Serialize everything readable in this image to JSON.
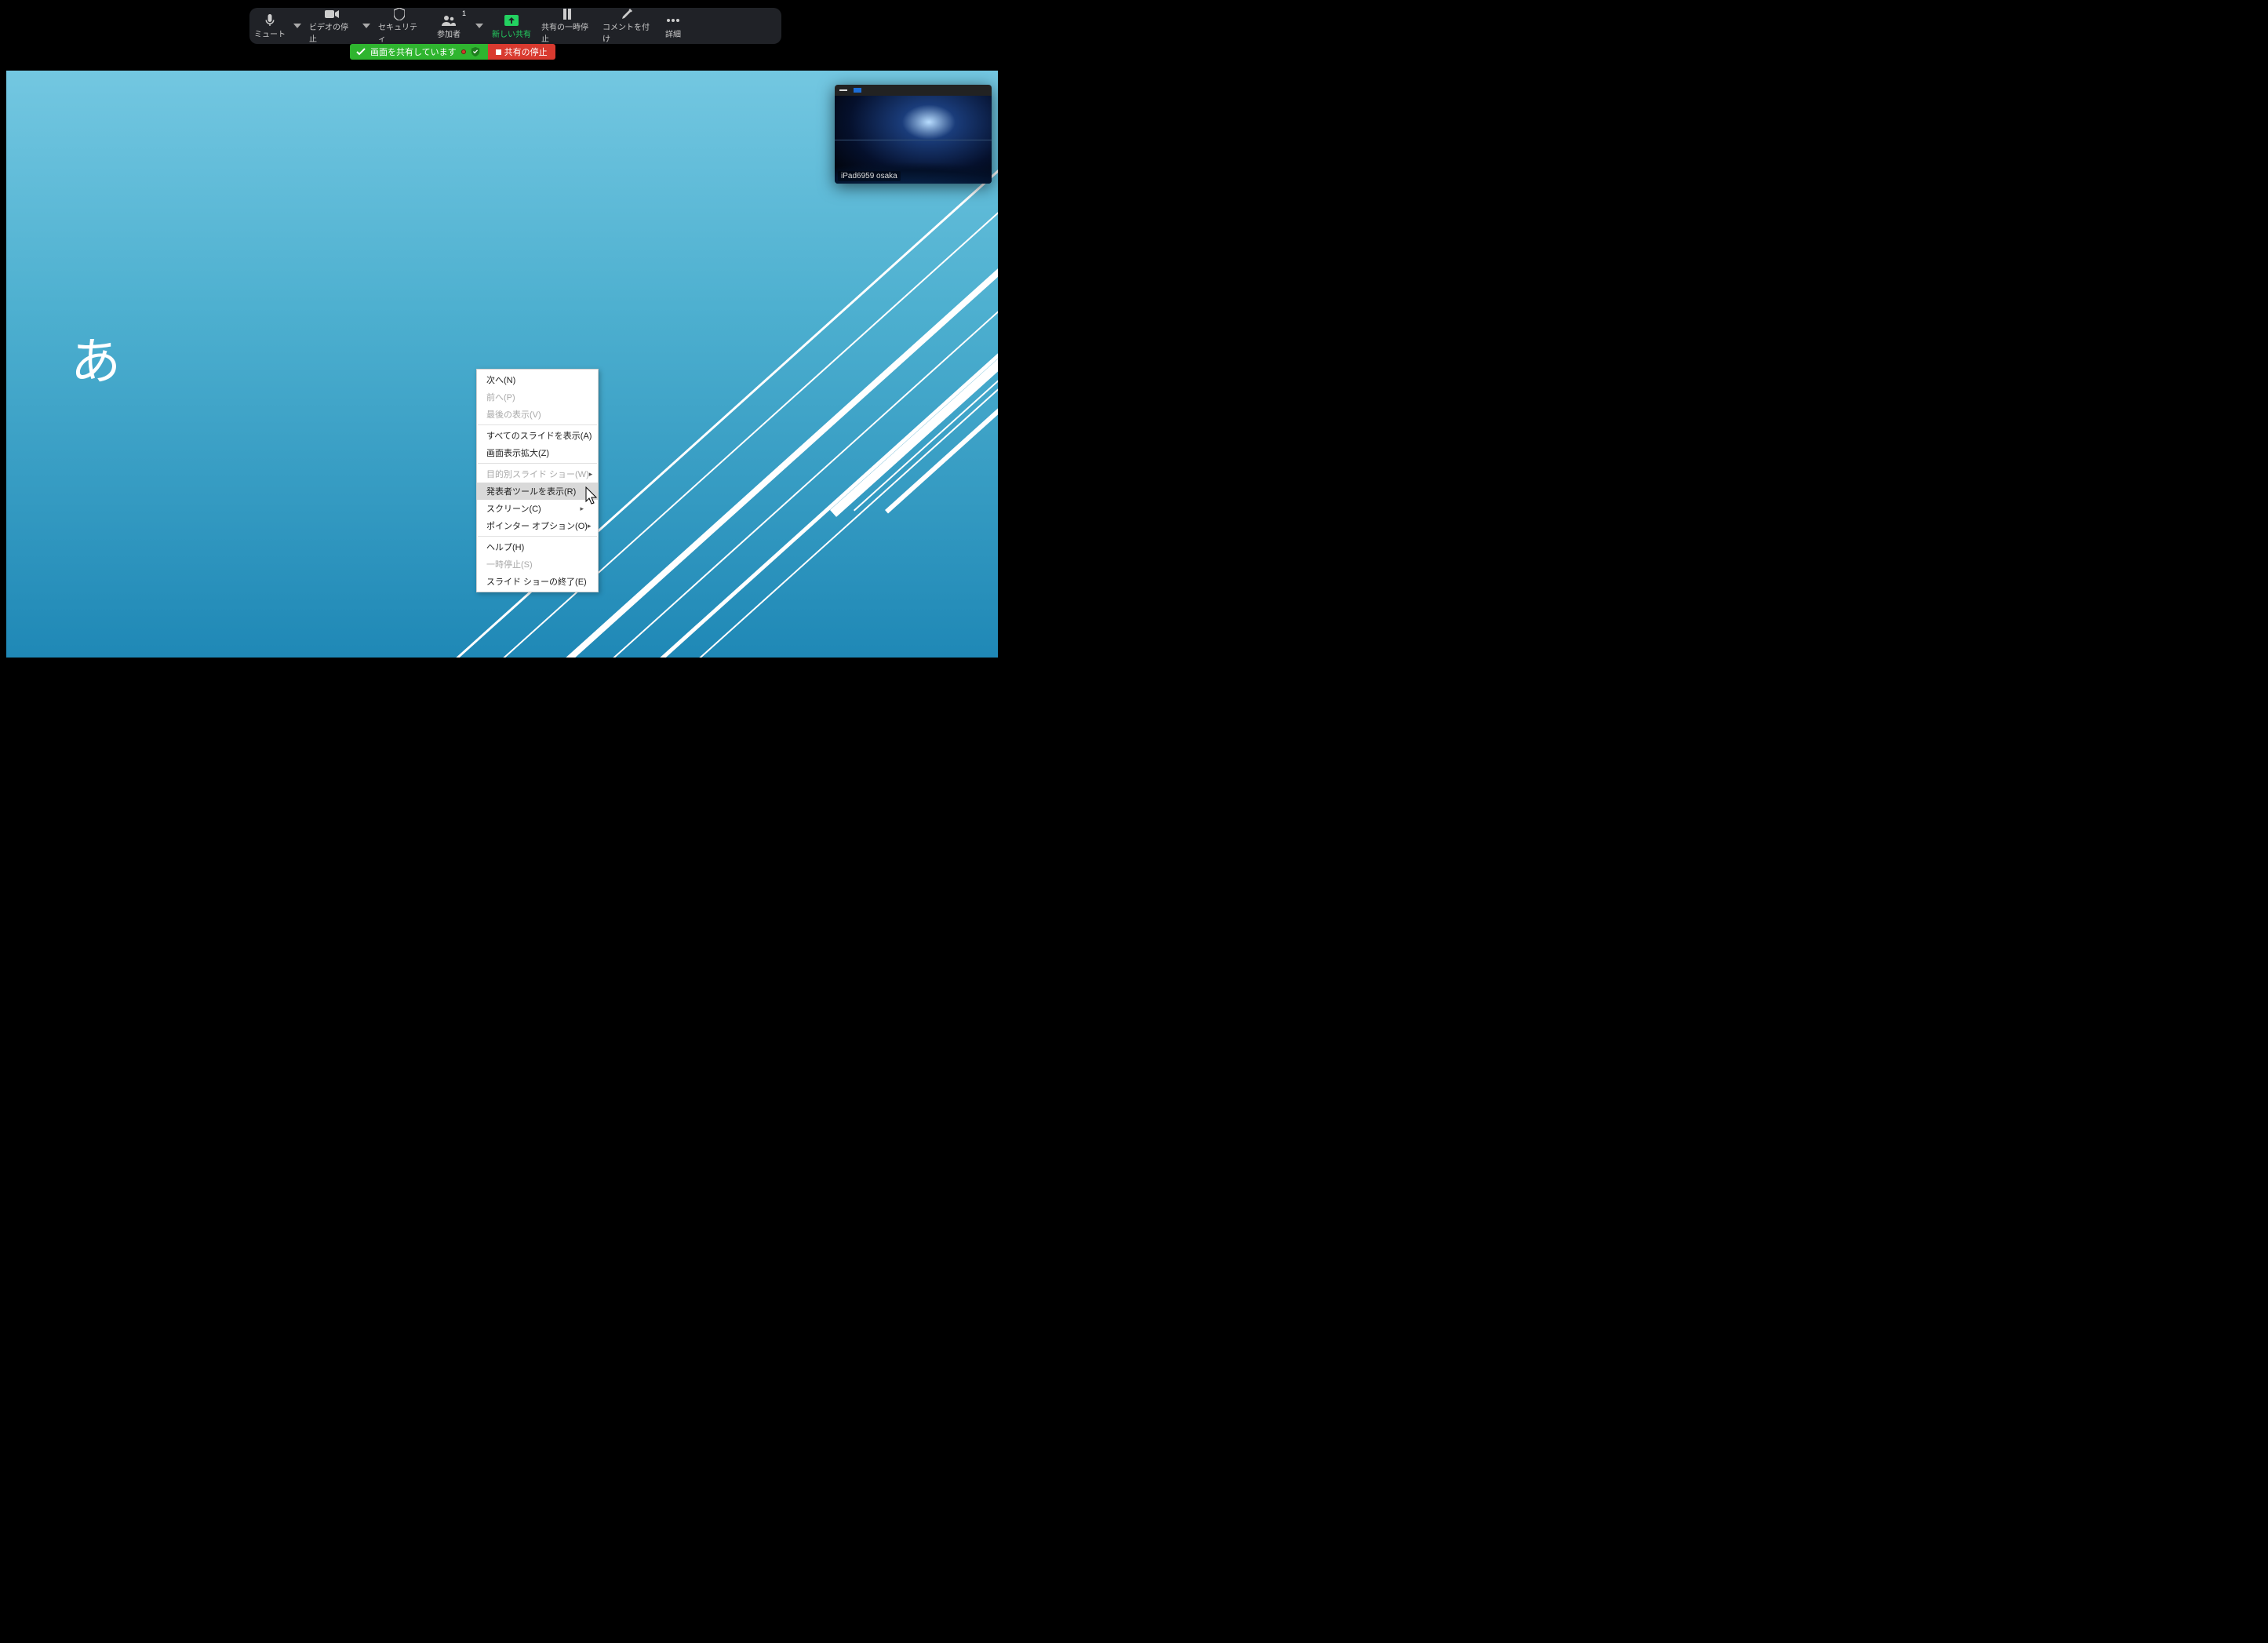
{
  "toolbar": {
    "mute": "ミュート",
    "video": "ビデオの停止",
    "security": "セキュリティ",
    "participants": "参加者",
    "participants_count": "1",
    "newshare": "新しい共有",
    "pauseshare": "共有の一時停止",
    "annotate": "コメントを付け",
    "more": "詳細"
  },
  "sharebar": {
    "sharing": "画面を共有しています",
    "stop": "共有の停止"
  },
  "thumbnail": {
    "name": "iPad6959 osaka"
  },
  "slide": {
    "text": "あ"
  },
  "menu": {
    "next": "次へ(N)",
    "prev": "前へ(P)",
    "last": "最後の表示(V)",
    "all": "すべてのスライドを表示(A)",
    "zoom": "画面表示拡大(Z)",
    "custom": "目的別スライド ショー(W)",
    "presenter": "発表者ツールを表示(R)",
    "screen": "スクリーン(C)",
    "pointer": "ポインター オプション(O)",
    "help": "ヘルプ(H)",
    "pause": "一時停止(S)",
    "end": "スライド ショーの終了(E)"
  }
}
